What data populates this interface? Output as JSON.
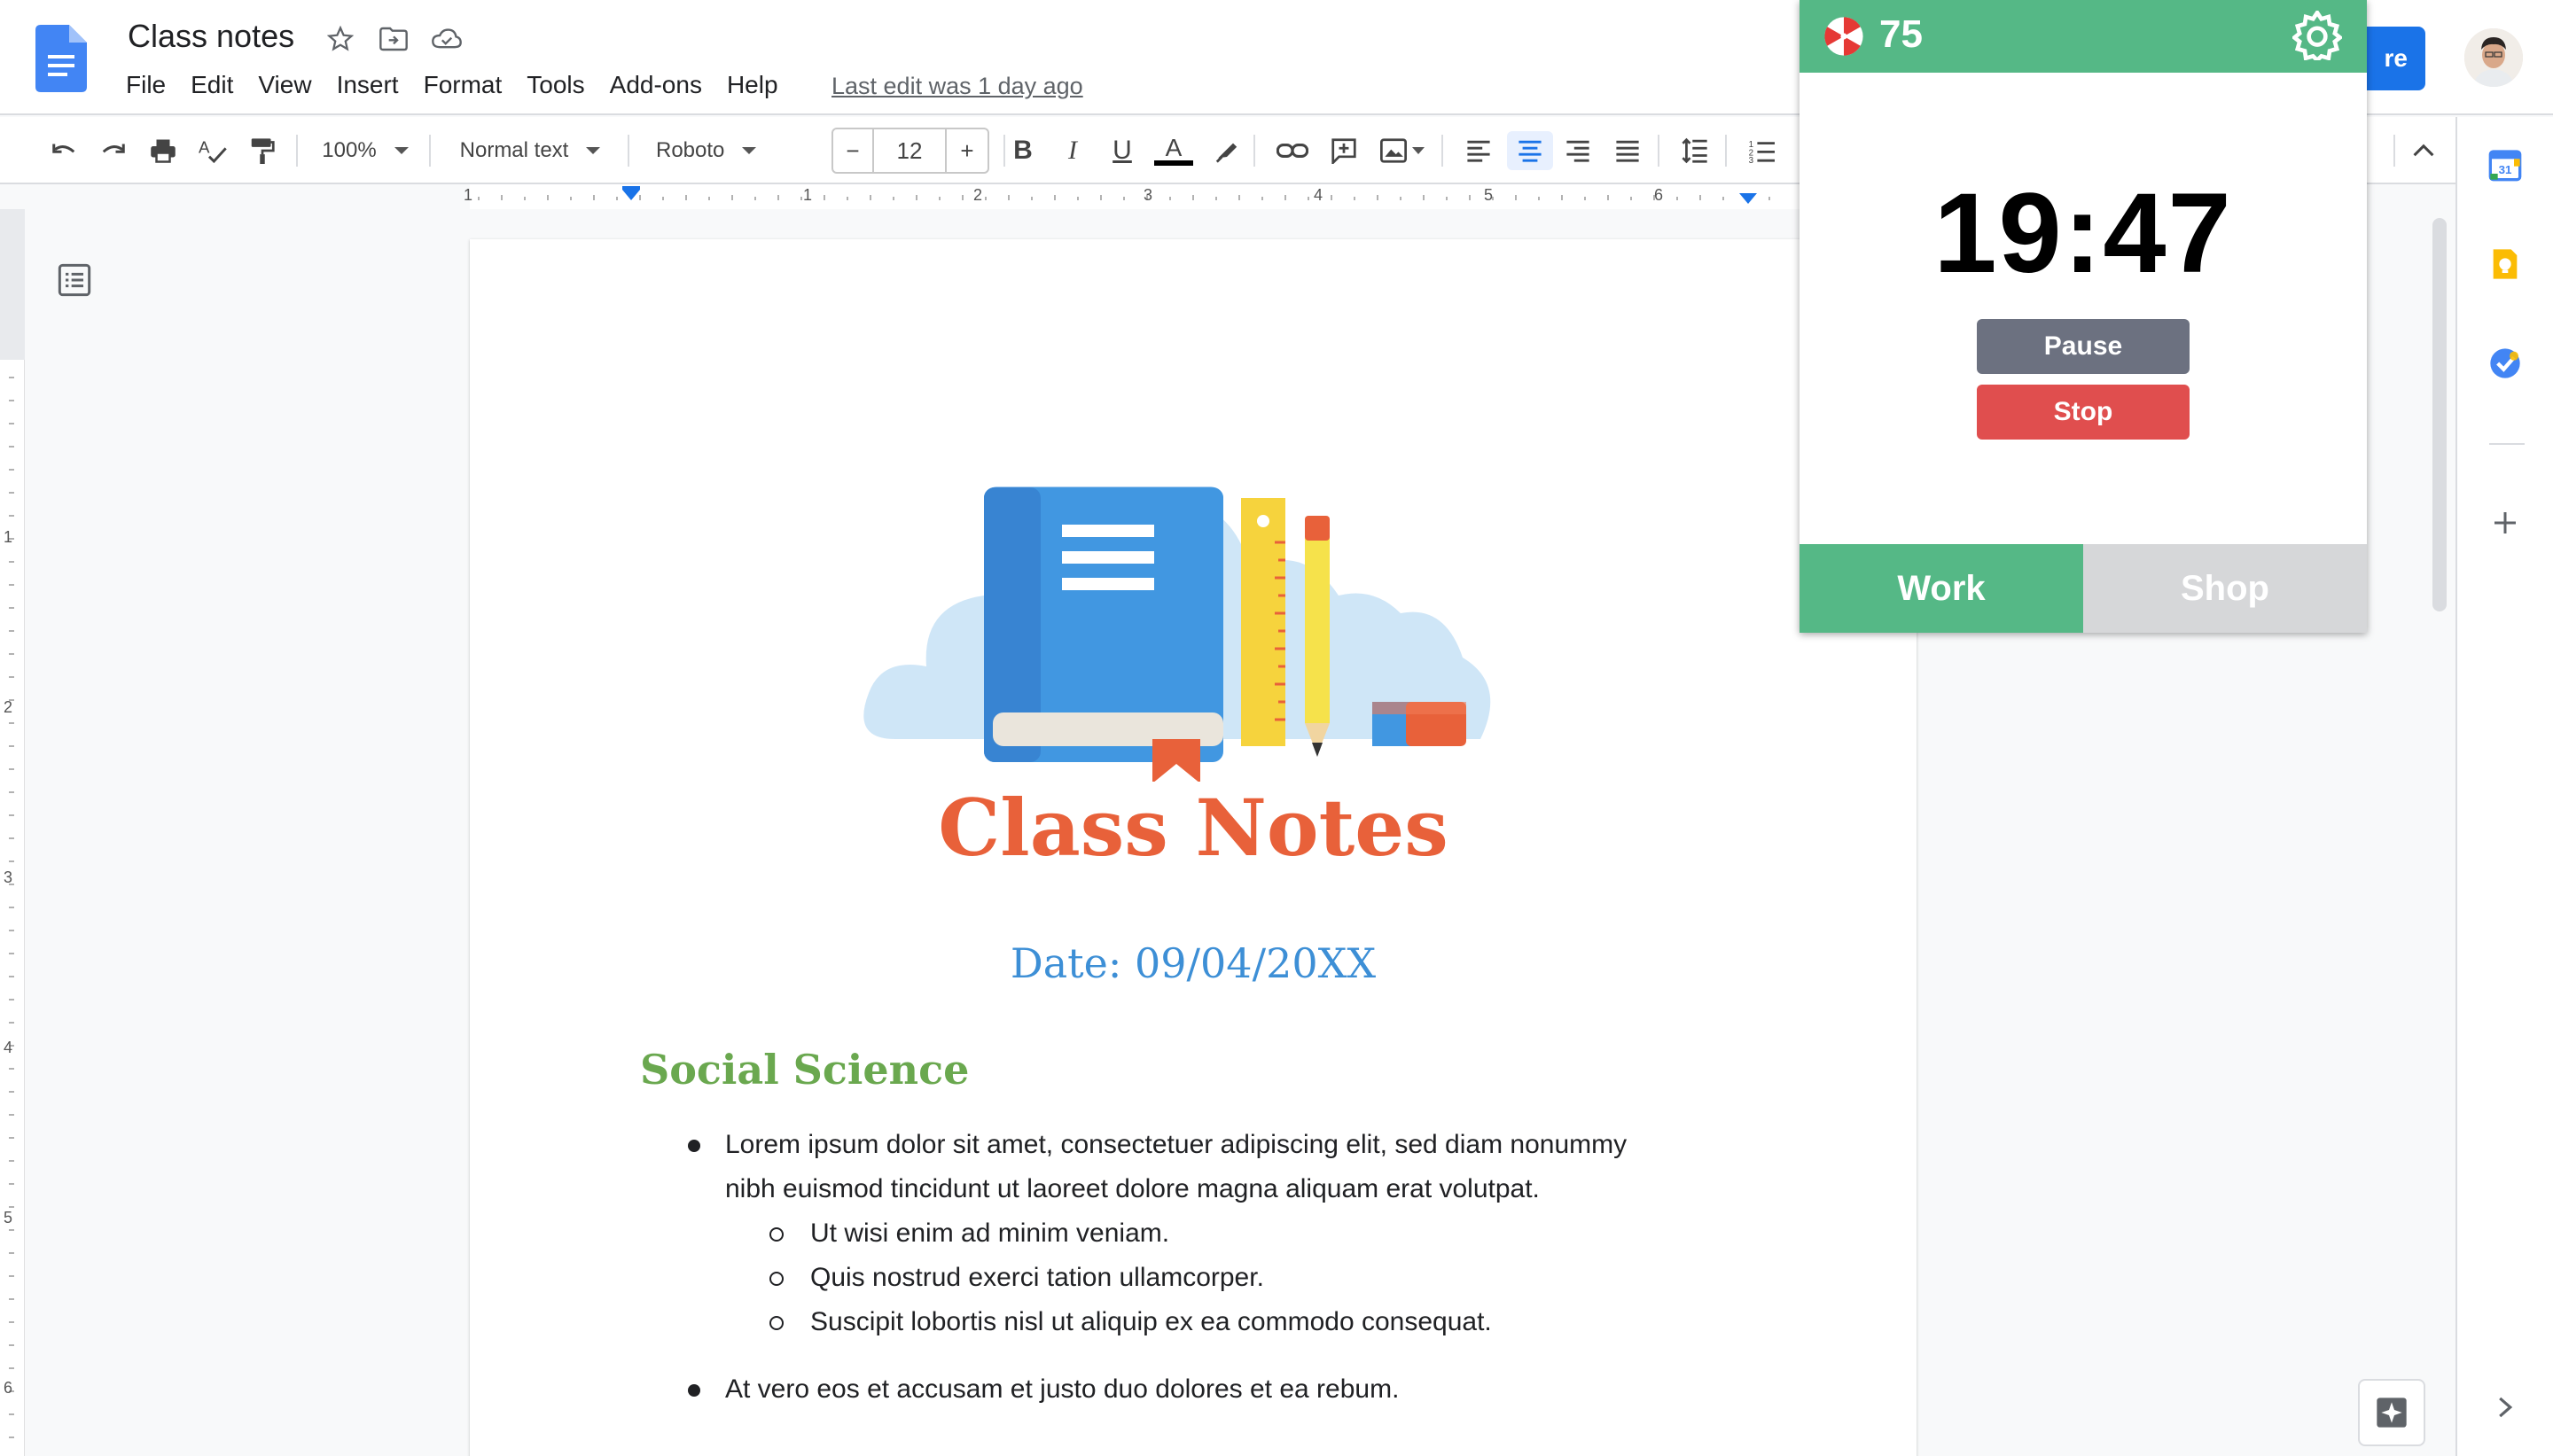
{
  "app": {
    "doc_title": "Class notes",
    "last_edit": "Last edit was 1 day ago",
    "share_label": "re"
  },
  "menu": [
    "File",
    "Edit",
    "View",
    "Insert",
    "Format",
    "Tools",
    "Add-ons",
    "Help"
  ],
  "toolbar": {
    "zoom": "100%",
    "style": "Normal text",
    "font": "Roboto",
    "font_size": "12",
    "minus": "−",
    "plus": "+"
  },
  "ruler": {
    "numbers": [
      "1",
      "1",
      "2",
      "3",
      "4",
      "5",
      "6"
    ],
    "vnumbers": [
      "1",
      "2",
      "3",
      "4",
      "5",
      "6"
    ]
  },
  "document": {
    "title": "Class Notes",
    "date": "Date: 09/04/20XX",
    "section": "Social Science",
    "bullets": [
      {
        "line1": "Lorem ipsum dolor sit amet, consectetuer adipiscing elit, sed diam nonummy",
        "line2": "nibh euismod tincidunt ut laoreet dolore magna aliquam erat volutpat."
      },
      {
        "line1": "At vero eos et accusam et justo duo dolores et ea rebum."
      }
    ],
    "sub_bullets": [
      "Ut wisi enim ad minim veniam.",
      "Quis nostrud exerci tation ullamcorper.",
      "Suscipit lobortis nisl ut aliquip ex ea commodo consequat."
    ]
  },
  "popup": {
    "coins": "75",
    "timer": "19:47",
    "pause_label": "Pause",
    "stop_label": "Stop",
    "tab_work": "Work",
    "tab_shop": "Shop",
    "accent": "#55b886",
    "stop_color": "#e04e4e"
  },
  "side_panel": {
    "calendar_day": "31"
  }
}
